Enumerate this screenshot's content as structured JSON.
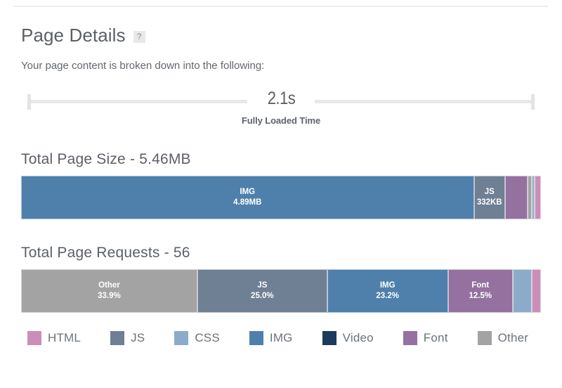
{
  "header": {
    "title": "Page Details",
    "help_icon_label": "?",
    "subtitle": "Your page content is broken down into the following:"
  },
  "fully_loaded": {
    "value": "2.1s",
    "label": "Fully Loaded Time"
  },
  "page_size": {
    "section_title": "Total Page Size - 5.46MB",
    "total": "5.46MB",
    "segments": [
      {
        "name": "IMG",
        "label": "IMG",
        "value": "4.89MB",
        "percent": 87.1,
        "color": "#4f80ab",
        "show_text": true
      },
      {
        "name": "JS",
        "label": "JS",
        "value": "332KB",
        "percent": 6.0,
        "color": "#6f7f94",
        "show_text": true
      },
      {
        "name": "Font",
        "label": "Font",
        "value": "",
        "percent": 4.4,
        "color": "#95719f",
        "show_text": false
      },
      {
        "name": "Other",
        "label": "Other",
        "value": "",
        "percent": 0.7,
        "color": "#a3a3a3",
        "show_text": false
      },
      {
        "name": "CSS",
        "label": "CSS",
        "value": "",
        "percent": 0.6,
        "color": "#8cabc8",
        "show_text": false
      },
      {
        "name": "HTML",
        "label": "HTML",
        "value": "",
        "percent": 1.2,
        "color": "#cb8eb7",
        "show_text": false
      }
    ]
  },
  "page_requests": {
    "section_title": "Total Page Requests - 56",
    "total": "56",
    "segments": [
      {
        "name": "Other",
        "label": "Other",
        "value": "33.9%",
        "percent": 33.9,
        "color": "#a3a3a3",
        "show_text": true
      },
      {
        "name": "JS",
        "label": "JS",
        "value": "25.0%",
        "percent": 25.0,
        "color": "#6f7f94",
        "show_text": true
      },
      {
        "name": "IMG",
        "label": "IMG",
        "value": "23.2%",
        "percent": 23.2,
        "color": "#4f80ab",
        "show_text": true
      },
      {
        "name": "Font",
        "label": "Font",
        "value": "12.5%",
        "percent": 12.5,
        "color": "#95719f",
        "show_text": true
      },
      {
        "name": "CSS",
        "label": "CSS",
        "value": "3.6%",
        "percent": 3.6,
        "color": "#8cabc8",
        "show_text": false
      },
      {
        "name": "HTML",
        "label": "HTML",
        "value": "1.8%",
        "percent": 1.8,
        "color": "#cb8eb7",
        "show_text": false
      }
    ]
  },
  "legend": {
    "items": [
      {
        "label": "HTML",
        "color": "#cb8eb7"
      },
      {
        "label": "JS",
        "color": "#6f7f94"
      },
      {
        "label": "CSS",
        "color": "#8cabc8"
      },
      {
        "label": "IMG",
        "color": "#4f80ab"
      },
      {
        "label": "Video",
        "color": "#1b3a5c"
      },
      {
        "label": "Font",
        "color": "#95719f"
      },
      {
        "label": "Other",
        "color": "#a3a3a3"
      }
    ]
  },
  "chart_data": {
    "type": "bar",
    "title": "Page Details",
    "charts": [
      {
        "title": "Total Page Size - 5.46MB",
        "type": "stacked-bar-horizontal",
        "categories": [
          "IMG",
          "JS",
          "Font",
          "Other",
          "CSS",
          "HTML"
        ],
        "values": [
          4.89,
          0.332,
          0.24,
          0.04,
          0.033,
          0.066
        ],
        "unit": "MB",
        "labels": [
          "4.89MB",
          "332KB",
          "",
          "",
          "",
          ""
        ],
        "percents": [
          87.1,
          6.0,
          4.4,
          0.7,
          0.6,
          1.2
        ],
        "colors": [
          "#4f80ab",
          "#6f7f94",
          "#95719f",
          "#a3a3a3",
          "#8cabc8",
          "#cb8eb7"
        ],
        "legend_position": "bottom"
      },
      {
        "title": "Total Page Requests - 56",
        "type": "stacked-bar-horizontal",
        "categories": [
          "Other",
          "JS",
          "IMG",
          "Font",
          "CSS",
          "HTML"
        ],
        "values": [
          33.9,
          25.0,
          23.2,
          12.5,
          3.6,
          1.8
        ],
        "unit": "%",
        "labels": [
          "33.9%",
          "25.0%",
          "23.2%",
          "12.5%",
          "",
          ""
        ],
        "percents": [
          33.9,
          25.0,
          23.2,
          12.5,
          3.6,
          1.8
        ],
        "colors": [
          "#a3a3a3",
          "#6f7f94",
          "#4f80ab",
          "#95719f",
          "#8cabc8",
          "#cb8eb7"
        ],
        "legend_position": "bottom"
      }
    ],
    "annotations": [
      {
        "text": "2.1s",
        "label": "Fully Loaded Time"
      }
    ],
    "grid": false
  }
}
